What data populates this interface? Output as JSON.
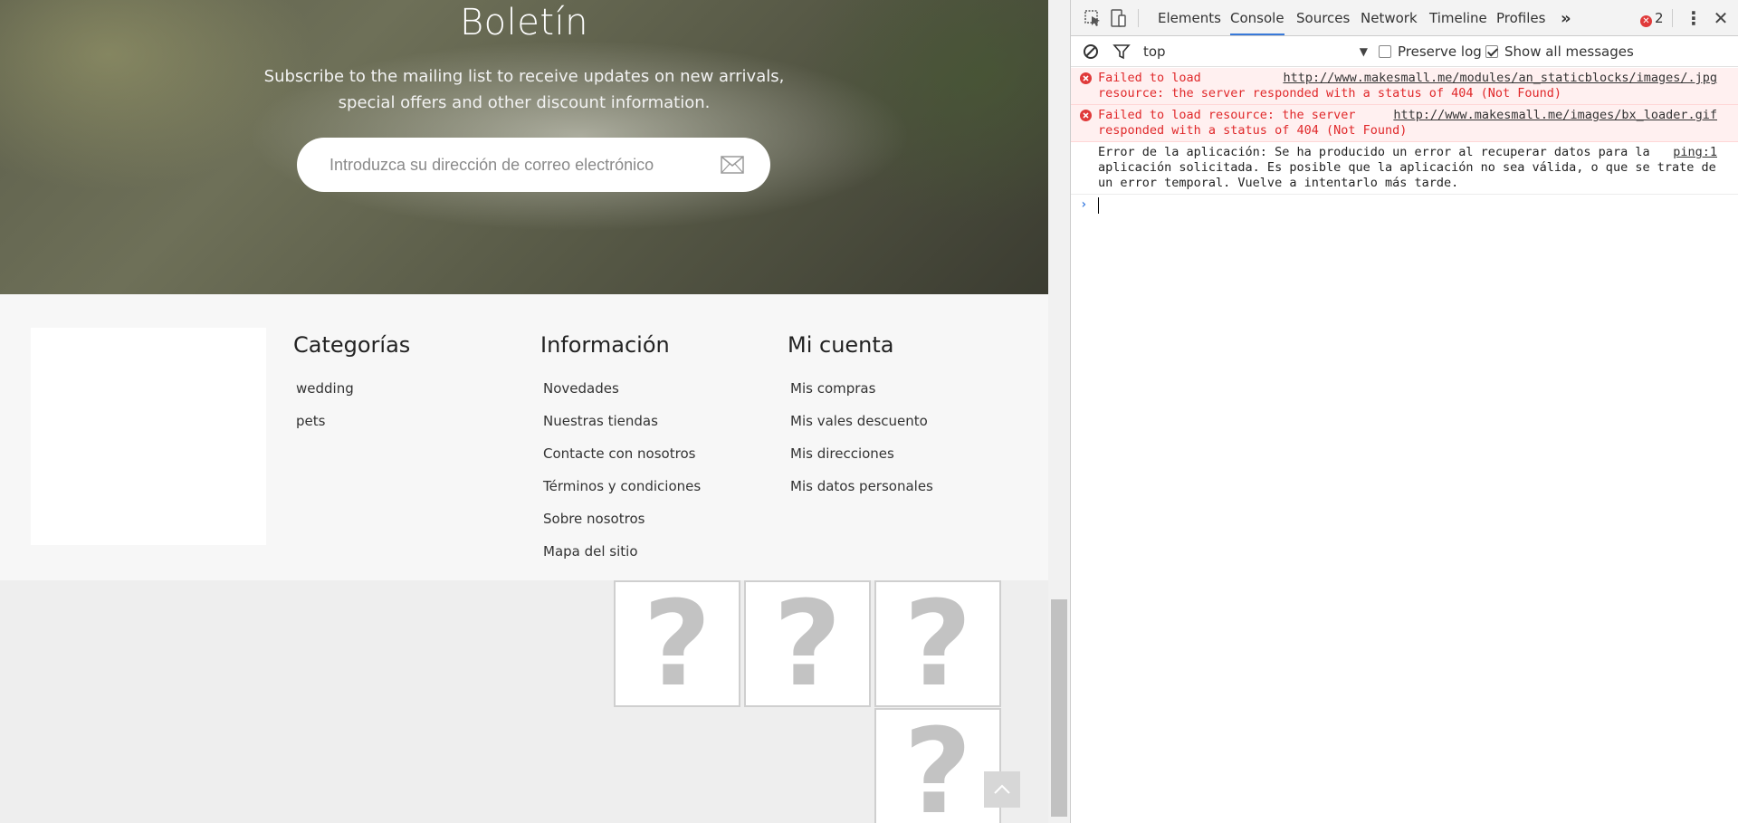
{
  "hero": {
    "title": "Boletín",
    "text": "Subscribe to the mailing list to receive updates on new arrivals, special offers and other discount information.",
    "email_placeholder": "Introduzca su dirección de correo electrónico"
  },
  "footer": {
    "columns": [
      {
        "title": "Categorías",
        "items": [
          "wedding",
          "pets"
        ]
      },
      {
        "title": "Información",
        "items": [
          "Novedades",
          "Nuestras tiendas",
          "Contacte con nosotros",
          "Términos y condiciones",
          "Sobre nosotros",
          "Mapa del sitio"
        ]
      },
      {
        "title": "Mi cuenta",
        "items": [
          "Mis compras",
          "Mis vales descuento",
          "Mis direcciones",
          "Mis datos personales"
        ]
      }
    ]
  },
  "placeholders": {
    "glyph": "?"
  },
  "icons": {
    "newsletter": "envelope-icon",
    "back_to_top": "chevron-up-icon",
    "inspect": "inspect-element-icon",
    "device": "device-toggle-icon",
    "clear": "clear-console-icon",
    "filter": "filter-icon",
    "error": "error-icon"
  },
  "devtools": {
    "tabs": [
      "Elements",
      "Console",
      "Sources",
      "Network",
      "Timeline",
      "Profiles"
    ],
    "active_tab": "Console",
    "more_tabs": "»",
    "error_count": "2",
    "menu": "⋮",
    "close": "✕",
    "context": "top",
    "preserve_log": {
      "label": "Preserve log",
      "checked": false
    },
    "show_all": {
      "label": "Show all messages",
      "checked": true
    },
    "messages": [
      {
        "level": "error",
        "text": "Failed to load resource: the server responded with a status of 404 (Not Found)",
        "source": "http://www.makesmall.me/modules/an_staticblocks/images/.jpg"
      },
      {
        "level": "error",
        "text": "Failed to load resource: the server responded with a status of 404 (Not Found)",
        "source": "http://www.makesmall.me/images/bx_loader.gif"
      },
      {
        "level": "info",
        "text": "Error de la aplicación: Se ha producido un error al recuperar datos para la aplicación solicitada. Es posible que la aplicación no sea válida, o que se trate de un error temporal. Vuelve a intentarlo más tarde.",
        "source": "ping:1"
      }
    ],
    "prompt": "›"
  },
  "colors": {
    "accent_tab": "#3879d9",
    "error_text": "#e0282a",
    "error_bg": "#fff0f0"
  }
}
